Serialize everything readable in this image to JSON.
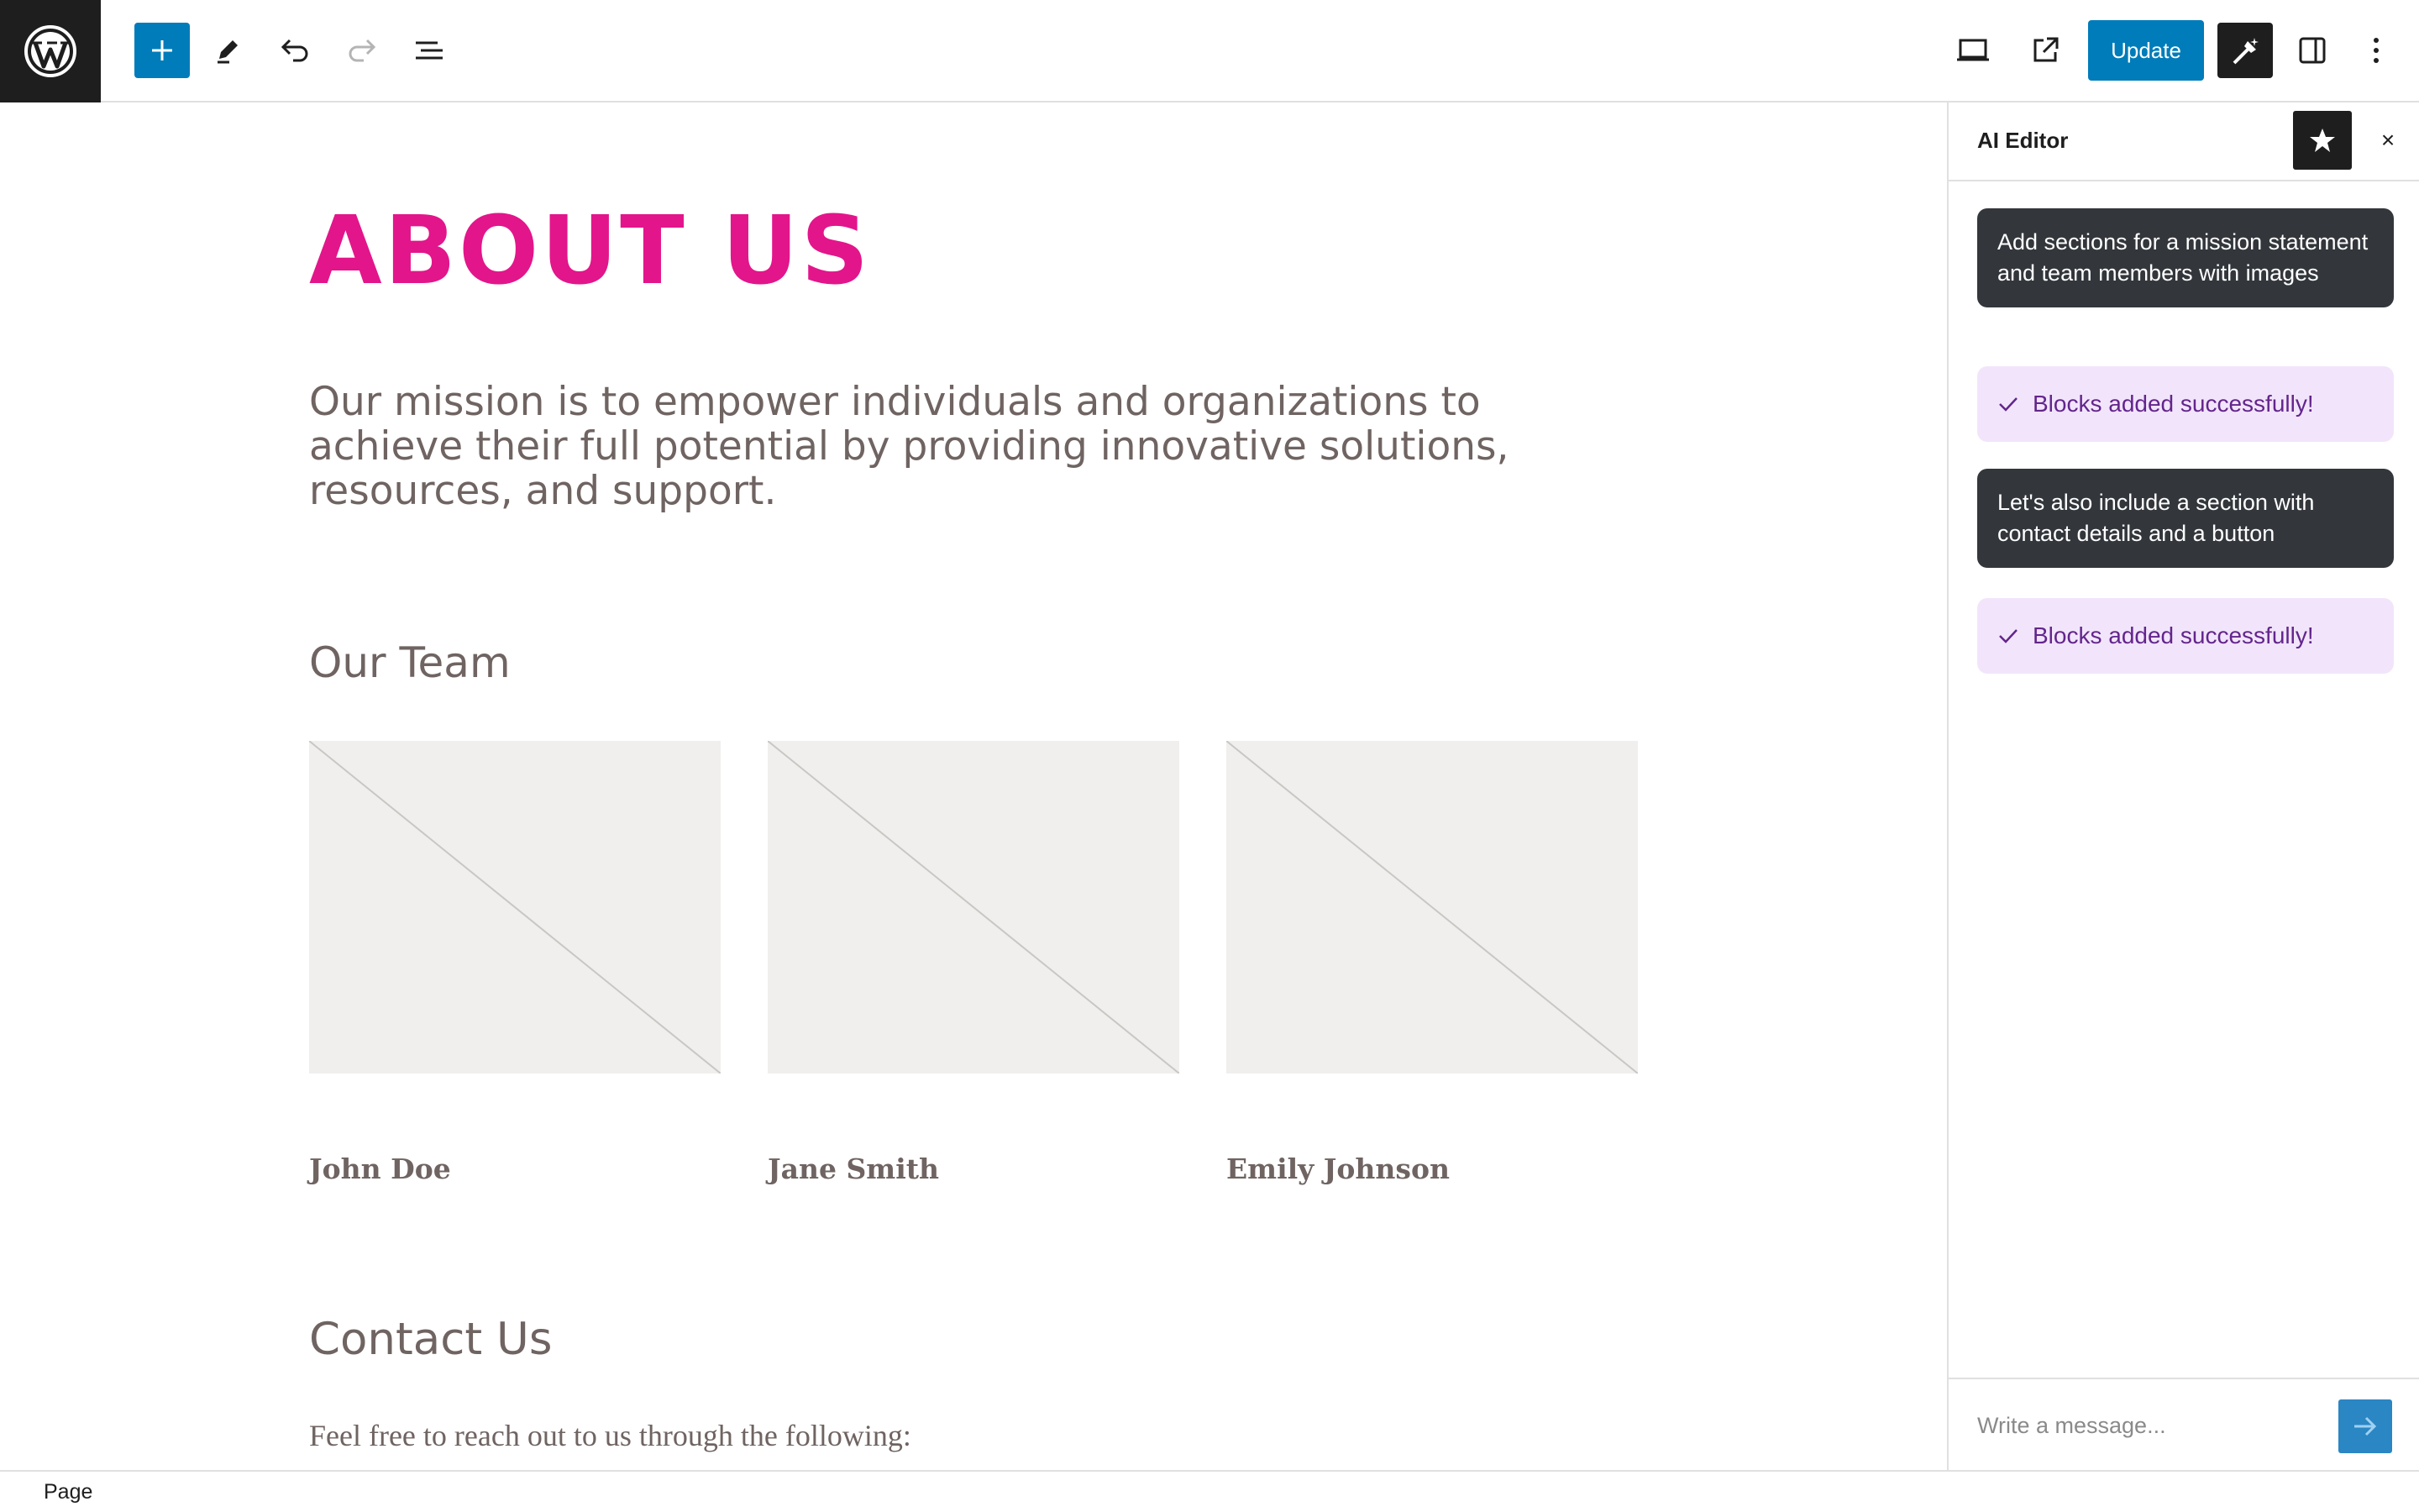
{
  "toolbar": {
    "update_label": "Update",
    "icons": [
      "wordpress-logo",
      "plus-icon",
      "pencil-icon",
      "undo-icon",
      "redo-icon",
      "list-view-icon",
      "desktop-icon",
      "external-link-icon",
      "ai-wand-icon",
      "sidebar-icon",
      "more-vertical-icon"
    ]
  },
  "page": {
    "title": "ABOUT US",
    "mission": "Our mission is to empower individuals and organizations to achieve their full potential by providing innovative solutions, resources, and support.",
    "team_heading": "Our Team",
    "team": [
      {
        "name": "John Doe"
      },
      {
        "name": "Jane Smith"
      },
      {
        "name": "Emily Johnson"
      }
    ],
    "contact_heading": "Contact Us",
    "contact_text": "Feel free to reach out to us through the following:"
  },
  "ai_editor": {
    "title": "AI Editor",
    "close_label": "×",
    "messages": [
      {
        "type": "user",
        "text": "Add sections for a mission statement and team members with images"
      },
      {
        "type": "status",
        "text": "Blocks added successfully!"
      },
      {
        "type": "user",
        "text": "Let's also include a section with contact details and a button"
      },
      {
        "type": "status",
        "text": "Blocks added successfully!"
      }
    ],
    "input_placeholder": "Write a message..."
  },
  "status_bar": {
    "label": "Page"
  },
  "colors": {
    "accent": "#007cba",
    "heading_pink": "#e3158b",
    "body_text": "#6f6462",
    "success_bg": "#f2e5fb",
    "success_text": "#63258c"
  }
}
